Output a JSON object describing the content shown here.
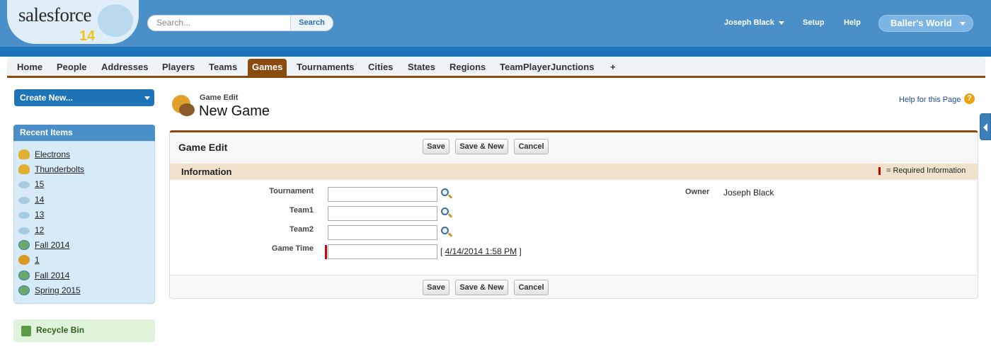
{
  "header": {
    "logo_text": "salesforce",
    "logo_version": "14",
    "search_placeholder": "Search...",
    "search_button": "Search",
    "user_name": "Joseph Black",
    "setup": "Setup",
    "help": "Help",
    "app_name": "Baller's World"
  },
  "tabs": [
    {
      "label": "Home"
    },
    {
      "label": "People"
    },
    {
      "label": "Addresses"
    },
    {
      "label": "Players"
    },
    {
      "label": "Teams"
    },
    {
      "label": "Games",
      "active": true
    },
    {
      "label": "Tournaments"
    },
    {
      "label": "Cities"
    },
    {
      "label": "States"
    },
    {
      "label": "Regions"
    },
    {
      "label": "TeamPlayerJunctions"
    },
    {
      "label": "+"
    }
  ],
  "sidebar": {
    "create_new": "Create New...",
    "recent_title": "Recent Items",
    "recent_items": [
      {
        "label": "Electrons",
        "icon": "team-icon"
      },
      {
        "label": "Thunderbolts",
        "icon": "team-icon"
      },
      {
        "label": "15",
        "icon": "disc-icon"
      },
      {
        "label": "14",
        "icon": "disc-icon"
      },
      {
        "label": "13",
        "icon": "disc-icon"
      },
      {
        "label": "12",
        "icon": "disc-icon"
      },
      {
        "label": "Fall 2014",
        "icon": "globe-icon"
      },
      {
        "label": "1",
        "icon": "game-icon"
      },
      {
        "label": "Fall 2014",
        "icon": "globe-icon"
      },
      {
        "label": "Spring 2015",
        "icon": "globe-icon"
      }
    ],
    "recycle_bin": "Recycle Bin"
  },
  "page": {
    "subtitle": "Game Edit",
    "title": "New Game",
    "help_link": "Help for this Page",
    "help_icon": "?"
  },
  "panel": {
    "title": "Game Edit",
    "save": "Save",
    "save_new": "Save & New",
    "cancel": "Cancel",
    "section_title": "Information",
    "required_info": "= Required Information"
  },
  "form": {
    "tournament_label": "Tournament",
    "tournament_value": "",
    "team1_label": "Team1",
    "team1_value": "",
    "team2_label": "Team2",
    "team2_value": "",
    "game_time_label": "Game Time",
    "game_time_value": "",
    "game_time_default": "4/14/2014 1:58 PM",
    "owner_label": "Owner",
    "owner_value": "Joseph Black"
  },
  "colors": {
    "header_blue": "#4a8fc7",
    "tab_accent": "#8a4b0f",
    "section_bg": "#f1e3cb",
    "required_red": "#cc0000"
  }
}
